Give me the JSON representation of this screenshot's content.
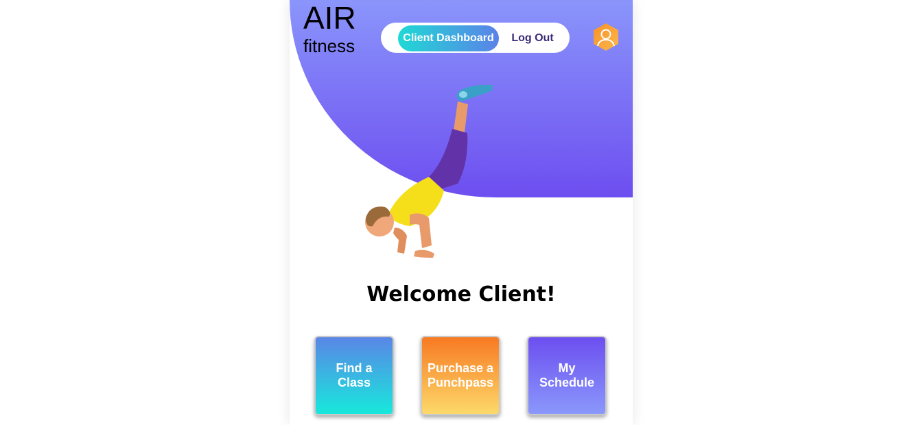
{
  "brand": {
    "title": "AIR",
    "subtitle": "fitness"
  },
  "nav": {
    "active_label": "Client Dashboard",
    "logout_label": "Log Out"
  },
  "welcome": {
    "text": "Welcome Client!"
  },
  "tiles": [
    {
      "label": "Find a Class"
    },
    {
      "label": "Purchase a Punchpass"
    },
    {
      "label": "My Schedule"
    }
  ],
  "colors": {
    "header_gradient": [
      "#8a95fb",
      "#6d4ef0"
    ],
    "nav_active_gradient": [
      "#1fd9d5",
      "#5b82e8"
    ],
    "tile_find_gradient": [
      "#5a86e6",
      "#17e8dc"
    ],
    "tile_punch_gradient": [
      "#f77a22",
      "#fdd96a"
    ],
    "tile_schedule_gradient": [
      "#6c4ff0",
      "#8a98fb"
    ]
  },
  "icons": {
    "profile": "user-avatar-icon",
    "hero": "handstand-exercise-illustration"
  }
}
